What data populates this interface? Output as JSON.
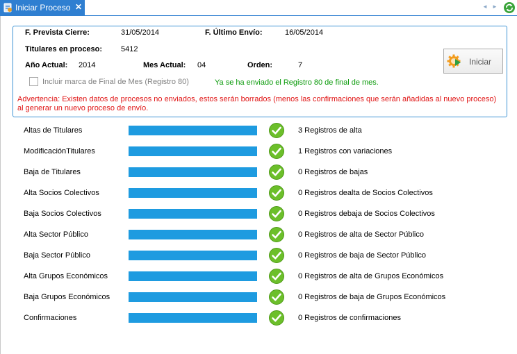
{
  "tab": {
    "title": "Iniciar Proceso",
    "close": "✕",
    "icon": "process-icon"
  },
  "nav": {
    "prev": "◄",
    "next": "►",
    "refresh_icon": "refresh-icon"
  },
  "info": {
    "fecha_prevista_label": "F. Prevista Cierre:",
    "fecha_prevista_value": "31/05/2014",
    "ultimo_envio_label": "F. Último Envío:",
    "ultimo_envio_value": "16/05/2014",
    "titulares_label": "Titulares en proceso:",
    "titulares_value": "5412",
    "anio_label": "Año Actual:",
    "anio_value": "2014",
    "mes_label": "Mes Actual:",
    "mes_value": "04",
    "orden_label": "Orden:",
    "orden_value": "7",
    "checkbox_label": "Incluir marca de Final de Mes (Registro 80)",
    "checkbox_checked": false,
    "registro80_note": "Ya se ha enviado el Registro 80 de final de mes.",
    "warning": "Advertencia: Existen datos de procesos no enviados, estos serán borrados (menos las confirmaciones que serán añadidas al nuevo proceso) al generar un nuevo proceso de envío.",
    "start_button": "Iniciar"
  },
  "colors": {
    "accent": "#2f7fd1",
    "bar": "#1e9be0",
    "ok": "#6cbf2a",
    "warning": "#e01515",
    "note": "#0a9a0a"
  },
  "steps": [
    {
      "label": "Altas de Titulares",
      "progress": 1.0,
      "status_icon": "check-icon",
      "status": "3 Registros de alta"
    },
    {
      "label": "ModificaciónTitulares",
      "progress": 1.0,
      "status_icon": "check-icon",
      "status": "1 Registros con variaciones"
    },
    {
      "label": "Baja de Titulares",
      "progress": 1.0,
      "status_icon": "check-icon",
      "status": "0 Registros de bajas"
    },
    {
      "label": "Alta Socios Colectivos",
      "progress": 1.0,
      "status_icon": "check-icon",
      "status": "0 Registros dealta de Socios Colectivos"
    },
    {
      "label": "Baja Socios Colectivos",
      "progress": 1.0,
      "status_icon": "check-icon",
      "status": "0 Registros debaja de Socios Colectivos"
    },
    {
      "label": "Alta Sector Público",
      "progress": 1.0,
      "status_icon": "check-icon",
      "status": "0 Registros de alta de Sector Público"
    },
    {
      "label": "Baja Sector Público",
      "progress": 1.0,
      "status_icon": "check-icon",
      "status": "0 Registros de baja de Sector Público"
    },
    {
      "label": "Alta Grupos Económicos",
      "progress": 1.0,
      "status_icon": "check-icon",
      "status": "0 Registros de alta de Grupos Económicos"
    },
    {
      "label": "Baja Grupos Económicos",
      "progress": 1.0,
      "status_icon": "check-icon",
      "status": "0 Registros de baja de Grupos Económicos"
    },
    {
      "label": "Confirmaciones",
      "progress": 1.0,
      "status_icon": "check-icon",
      "status": "0 Registros de confirmaciones"
    }
  ]
}
